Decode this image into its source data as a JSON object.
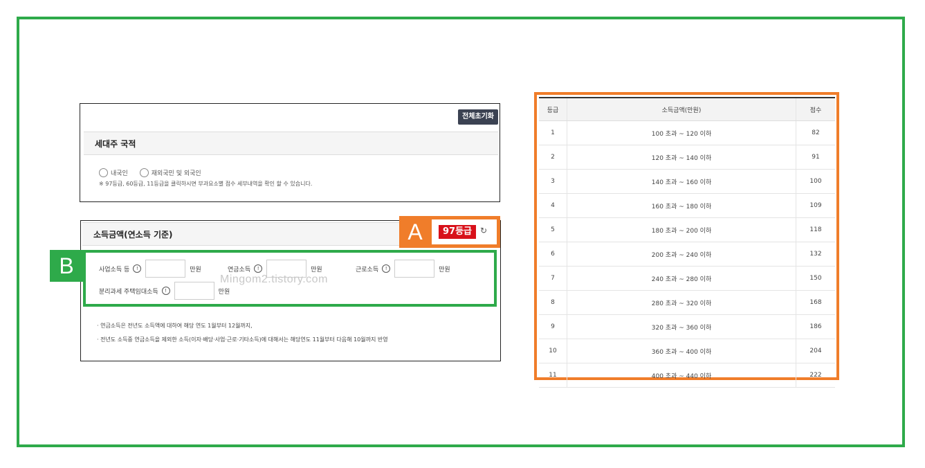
{
  "colors": {
    "green": "#2eaa4a",
    "orange": "#f07d2a",
    "grade_red": "#d8111a",
    "dark_button": "#3b4252"
  },
  "panel1": {
    "reset_label": "전체초기화",
    "section_title": "세대주 국적",
    "radio_options": [
      "내국인",
      "재외국민 및 외국인"
    ],
    "note": "※ 97등급, 60등급, 11등급을 클릭하시면 부과요소별 점수 세부내역을 확인 할 수 있습니다."
  },
  "panel2": {
    "section_title": "소득금액(연소득 기준)",
    "annotation_a": "A",
    "grade_badge": "97등급",
    "annotation_b": "B",
    "fields": [
      {
        "label": "사업소득 등",
        "unit": "만원",
        "value": ""
      },
      {
        "label": "연금소득",
        "unit": "만원",
        "value": ""
      },
      {
        "label": "근로소득",
        "unit": "만원",
        "value": ""
      },
      {
        "label": "분리과세 주택임대소득",
        "unit": "만원",
        "value": ""
      }
    ],
    "info_glyph": "!",
    "watermark": "Mingom2.tistory.com",
    "bullets": [
      "· 연금소득은 전년도 소득액에 대하여 해당 연도 1월부터 12월까지,",
      "· 전년도 소득중 연금소득을 제외한 소득(이자·배당·사업·근로·기타소득)에 대해서는 해당연도 11월부터 다음해 10월까지 반영"
    ]
  },
  "table": {
    "headers": [
      "등급",
      "소득금액(만원)",
      "점수"
    ],
    "rows": [
      [
        "1",
        "100 초과 ~ 120 이하",
        "82"
      ],
      [
        "2",
        "120 초과 ~ 140 이하",
        "91"
      ],
      [
        "3",
        "140 초과 ~ 160 이하",
        "100"
      ],
      [
        "4",
        "160 초과 ~ 180 이하",
        "109"
      ],
      [
        "5",
        "180 초과 ~ 200 이하",
        "118"
      ],
      [
        "6",
        "200 초과 ~ 240 이하",
        "132"
      ],
      [
        "7",
        "240 초과 ~ 280 이하",
        "150"
      ],
      [
        "8",
        "280 초과 ~ 320 이하",
        "168"
      ],
      [
        "9",
        "320 초과 ~ 360 이하",
        "186"
      ],
      [
        "10",
        "360 초과 ~ 400 이하",
        "204"
      ],
      [
        "11",
        "400 초과 ~ 440 이하",
        "222"
      ]
    ]
  }
}
